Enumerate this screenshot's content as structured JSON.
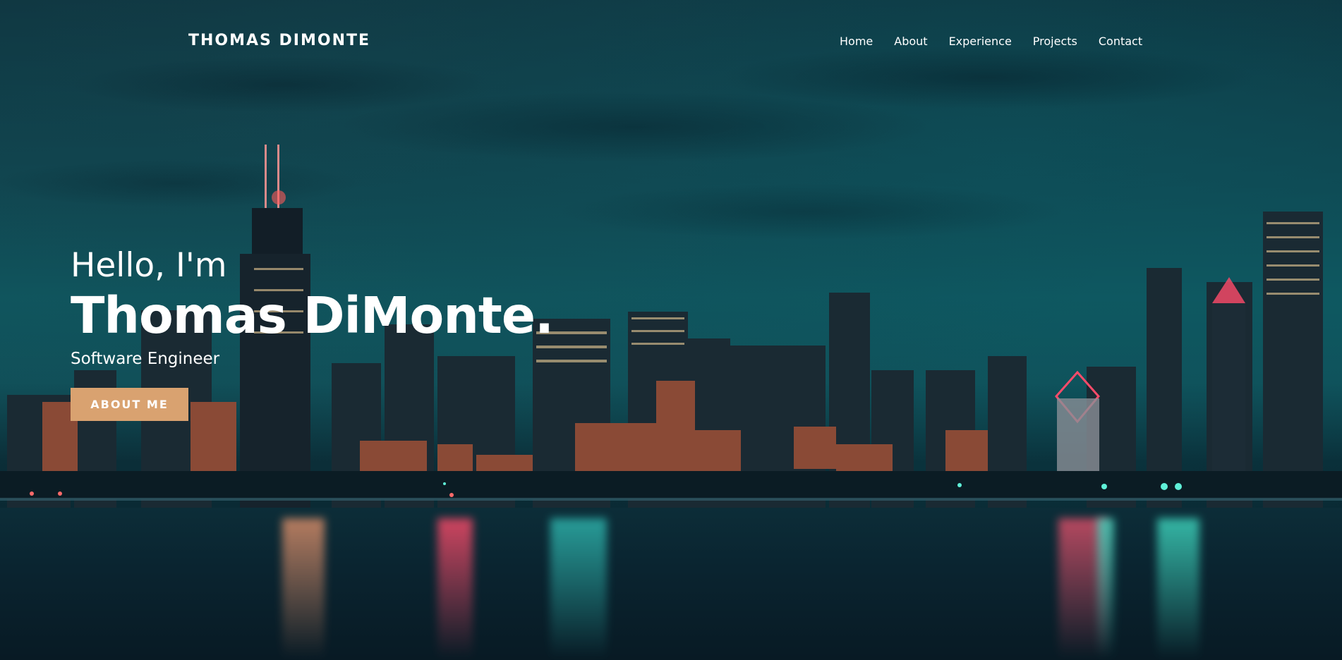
{
  "header": {
    "brand": "THOMAS DIMONTE",
    "nav": [
      {
        "label": "Home"
      },
      {
        "label": "About"
      },
      {
        "label": "Experience"
      },
      {
        "label": "Projects"
      },
      {
        "label": "Contact"
      }
    ]
  },
  "hero": {
    "greeting": "Hello, I'm",
    "name": "Thomas DiMonte.",
    "role": "Software Engineer",
    "cta_label": "ABOUT ME",
    "background_image": "city-skyline-night",
    "accent_color": "#d9a270"
  }
}
